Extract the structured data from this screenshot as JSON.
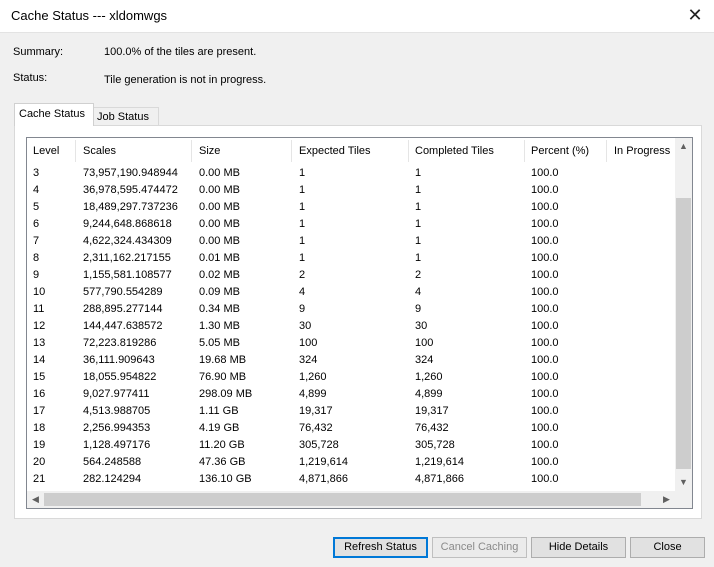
{
  "window": {
    "title": "Cache Status --- xldomwgs",
    "close_glyph": "✕"
  },
  "summary": {
    "summary_label": "Summary:",
    "summary_value": "100.0% of the tiles are present.",
    "status_label": "Status:",
    "status_value": "Tile generation is not in progress."
  },
  "tabs": [
    {
      "label": "Cache Status",
      "active": true
    },
    {
      "label": "Job Status",
      "active": false
    }
  ],
  "table": {
    "columns": [
      "Level",
      "Scales",
      "Size",
      "Expected Tiles",
      "Completed Tiles",
      "Percent (%)",
      "In Progress"
    ],
    "rows": [
      [
        "3",
        "73,957,190.948944",
        "0.00 MB",
        "1",
        "1",
        "100.0"
      ],
      [
        "4",
        "36,978,595.474472",
        "0.00 MB",
        "1",
        "1",
        "100.0"
      ],
      [
        "5",
        "18,489,297.737236",
        "0.00 MB",
        "1",
        "1",
        "100.0"
      ],
      [
        "6",
        "9,244,648.868618",
        "0.00 MB",
        "1",
        "1",
        "100.0"
      ],
      [
        "7",
        "4,622,324.434309",
        "0.00 MB",
        "1",
        "1",
        "100.0"
      ],
      [
        "8",
        "2,311,162.217155",
        "0.01 MB",
        "1",
        "1",
        "100.0"
      ],
      [
        "9",
        "1,155,581.108577",
        "0.02 MB",
        "2",
        "2",
        "100.0"
      ],
      [
        "10",
        "577,790.554289",
        "0.09 MB",
        "4",
        "4",
        "100.0"
      ],
      [
        "11",
        "288,895.277144",
        "0.34 MB",
        "9",
        "9",
        "100.0"
      ],
      [
        "12",
        "144,447.638572",
        "1.30 MB",
        "30",
        "30",
        "100.0"
      ],
      [
        "13",
        "72,223.819286",
        "5.05 MB",
        "100",
        "100",
        "100.0"
      ],
      [
        "14",
        "36,111.909643",
        "19.68 MB",
        "324",
        "324",
        "100.0"
      ],
      [
        "15",
        "18,055.954822",
        "76.90 MB",
        "1,260",
        "1,260",
        "100.0"
      ],
      [
        "16",
        "9,027.977411",
        "298.09 MB",
        "4,899",
        "4,899",
        "100.0"
      ],
      [
        "17",
        "4,513.988705",
        "1.11 GB",
        "19,317",
        "19,317",
        "100.0"
      ],
      [
        "18",
        "2,256.994353",
        "4.19 GB",
        "76,432",
        "76,432",
        "100.0"
      ],
      [
        "19",
        "1,128.497176",
        "11.20 GB",
        "305,728",
        "305,728",
        "100.0"
      ],
      [
        "20",
        "564.248588",
        "47.36 GB",
        "1,219,614",
        "1,219,614",
        "100.0"
      ],
      [
        "21",
        "282.124294",
        "136.10 GB",
        "4,871,866",
        "4,871,866",
        "100.0"
      ]
    ]
  },
  "scroll": {
    "up": "▲",
    "down": "▼",
    "left": "◀",
    "right": "▶"
  },
  "buttons": {
    "refresh": "Refresh Status",
    "cancel_caching": "Cancel Caching",
    "hide_details": "Hide Details",
    "close": "Close"
  }
}
